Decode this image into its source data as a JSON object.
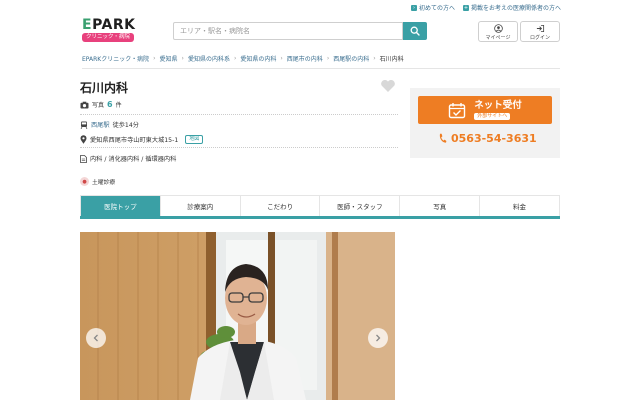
{
  "topbar": {
    "first_time_link": "初めての方へ",
    "listing_link": "掲載をお考えの医療関係者の方へ"
  },
  "logo": {
    "main": "EPARK",
    "sub": "クリニック・病院"
  },
  "search": {
    "placeholder": "エリア・駅名・病院名"
  },
  "header_buttons": {
    "mypage": "マイページ",
    "login": "ログイン"
  },
  "breadcrumb": [
    "EPARKクリニック・病院",
    "愛知県",
    "愛知県の内科系",
    "愛知県の内科",
    "西尾市の内科",
    "西尾駅の内科",
    "石川内科"
  ],
  "clinic": {
    "name": "石川内科",
    "photos_label": "写真",
    "photos_count": "6",
    "photos_unit": "件",
    "station": "西尾駅",
    "walk": "徒歩14分",
    "address": "愛知県西尾市寺山町東大城15-1",
    "map_label": "地図",
    "departments": "内科 / 消化器内科 / 循環器内科",
    "badge": "土曜診療"
  },
  "reservation": {
    "net_title": "ネット受付",
    "net_sub": "外部サイトへ",
    "phone": "0563-54-3631"
  },
  "tabs": [
    {
      "label": "医院トップ",
      "active": true
    },
    {
      "label": "診療案内",
      "active": false
    },
    {
      "label": "こだわり",
      "active": false
    },
    {
      "label": "医師・スタッフ",
      "active": false
    },
    {
      "label": "写真",
      "active": false
    },
    {
      "label": "料金",
      "active": false
    }
  ],
  "colors": {
    "teal": "#3aa0a5",
    "orange": "#ee7d23",
    "pink": "#e8417d",
    "link": "#3a6e8f"
  }
}
